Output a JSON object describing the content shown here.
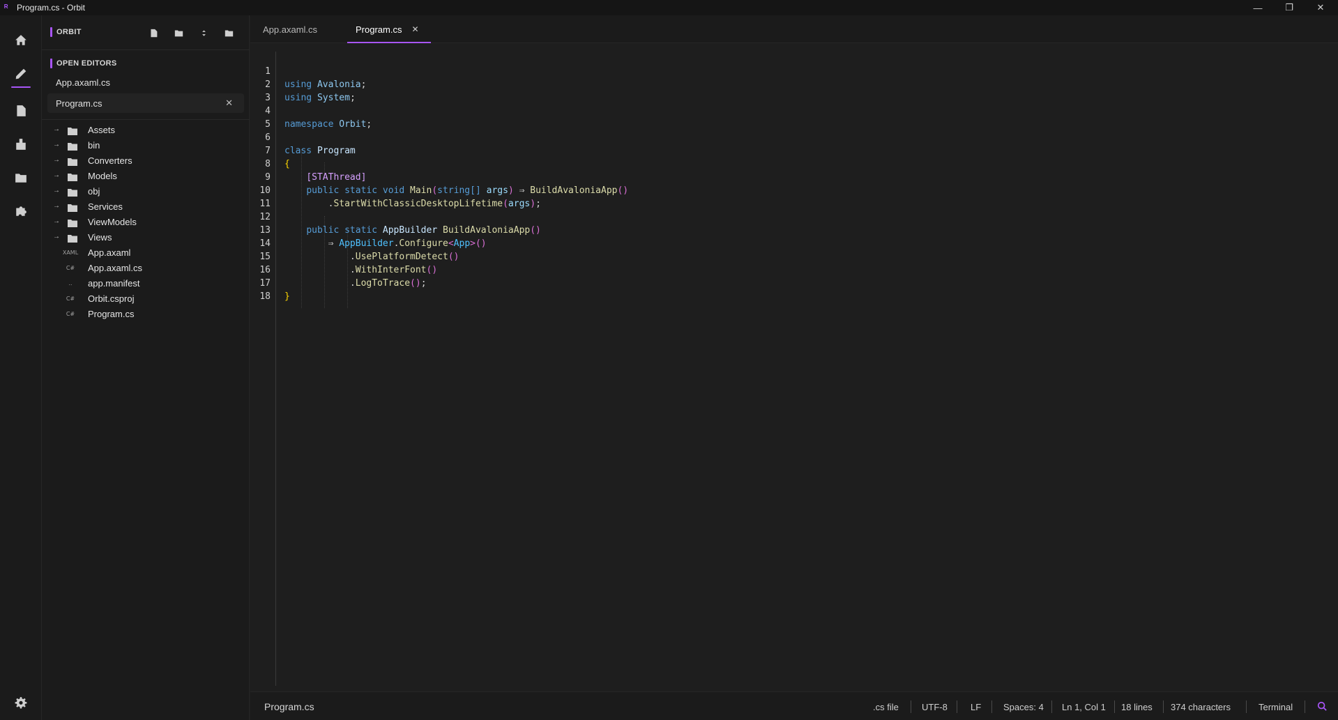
{
  "window": {
    "title": "Program.cs - Orbit",
    "minimize_glyph": "—",
    "restore_glyph": "❐",
    "close_glyph": "✕"
  },
  "activity_bar": {
    "items": [
      {
        "icon": "home-icon"
      },
      {
        "icon": "pencil-icon",
        "active": true
      },
      {
        "icon": "file-icon"
      },
      {
        "icon": "package-icon"
      },
      {
        "icon": "folder-icon"
      },
      {
        "icon": "puzzle-icon"
      }
    ],
    "settings_icon": "gear-icon"
  },
  "sidebar": {
    "header_label": "ORBIT",
    "tools": [
      "new-file-icon",
      "new-folder-icon",
      "collapse-icon",
      "open-folder-icon"
    ],
    "open_editors_label": "OPEN EDITORS",
    "open_editors": [
      {
        "name": "App.axaml.cs"
      },
      {
        "name": "Program.cs",
        "close": "✕"
      }
    ],
    "tree": [
      {
        "name": "Assets",
        "chev": "→"
      },
      {
        "name": "bin",
        "chev": "→"
      },
      {
        "name": "Converters",
        "chev": "→"
      },
      {
        "name": "Models",
        "chev": "→"
      },
      {
        "name": "obj",
        "chev": "→"
      },
      {
        "name": "Services",
        "chev": "→"
      },
      {
        "name": "ViewModels",
        "chev": "→"
      },
      {
        "name": "Views",
        "chev": "→"
      },
      {
        "name": "App.axaml",
        "type": "XAML"
      },
      {
        "name": "App.axaml.cs",
        "type": "C#"
      },
      {
        "name": "app.manifest",
        "type": ".."
      },
      {
        "name": "Orbit.csproj",
        "type": "C#"
      },
      {
        "name": "Program.cs",
        "type": "C#"
      }
    ]
  },
  "tabs": [
    {
      "label": "App.axaml.cs"
    },
    {
      "label": "Program.cs",
      "active": true,
      "close": "✕"
    }
  ],
  "editor": {
    "line_numbers": [
      "1",
      "2",
      "3",
      "4",
      "5",
      "6",
      "7",
      "8",
      "9",
      "10",
      "11",
      "12",
      "13",
      "14",
      "15",
      "16",
      "17",
      "18"
    ],
    "tokens": {
      "l1_kw": "using",
      "l1_ns": "Avalonia",
      "l1_semi": ";",
      "l2_kw": "using",
      "l2_ns": "System",
      "l2_semi": ";",
      "l4_kw": "namespace",
      "l4_ns": "Orbit",
      "l4_semi": ";",
      "l6_kw": "class",
      "l6_name": "Program",
      "l7_brace": "{",
      "l8_attr": "[STAThread]",
      "l9_kw": "public static void",
      "l9_fn": "Main",
      "l9_po": "(",
      "l9_ty": "string[]",
      "l9_arg": "args",
      "l9_pc": ")",
      "l9_arrow": "⇒",
      "l9_call": "BuildAvaloniaApp",
      "l9_parens": "()",
      "l10_dot": ".",
      "l10_fn": "StartWithClassicDesktopLifetime",
      "l10_po": "(",
      "l10_arg": "args",
      "l10_pc": ")",
      "l10_semi": ";",
      "l12_kw": "public static",
      "l12_ty": "AppBuilder",
      "l12_fn": "BuildAvaloniaApp",
      "l12_parens": "()",
      "l13_arrow": "⇒",
      "l13_ty": "AppBuilder",
      "l13_dot": ".",
      "l13_fn": "Configure",
      "l13_lt": "<",
      "l13_gen": "App",
      "l13_gt": ">",
      "l13_parens": "()",
      "l14_dot": ".",
      "l14_fn": "UsePlatformDetect",
      "l14_parens": "()",
      "l15_dot": ".",
      "l15_fn": "WithInterFont",
      "l15_parens": "()",
      "l16_dot": ".",
      "l16_fn": "LogToTrace",
      "l16_parens": "()",
      "l16_semi": ";",
      "l17_brace": "}"
    }
  },
  "status_bar": {
    "file": "Program.cs",
    "file_type": ".cs file",
    "encoding": "UTF-8",
    "line_ending": "LF",
    "indent": "Spaces: 4",
    "cursor": "Ln 1, Col 1",
    "lines": "18 lines",
    "chars": "374 characters",
    "terminal": "Terminal"
  },
  "colors": {
    "accent": "#a855f7",
    "background": "#1e1e1e",
    "sidebar": "#1b1b1b"
  }
}
